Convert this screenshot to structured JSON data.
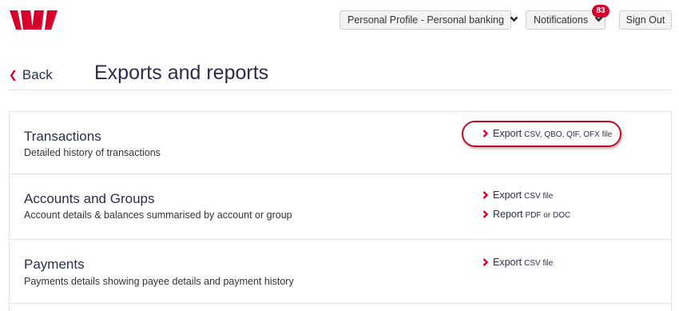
{
  "header": {
    "brand_color": "#d5002b",
    "logo_icon": "westpac-w-logo",
    "profile_label": "Personal Profile - Personal banking",
    "notifications_label": "Notifications",
    "notifications_count": "83",
    "signout_label": "Sign Out"
  },
  "nav": {
    "back_label": "Back"
  },
  "page": {
    "title": "Exports and reports"
  },
  "rows": [
    {
      "title": "Transactions",
      "description": "Detailed history of transactions",
      "actions": [
        {
          "verb": "Export",
          "formats": "CSV, QBO, QIF, OFX file",
          "highlighted": true
        }
      ]
    },
    {
      "title": "Accounts and Groups",
      "description": "Account details & balances summarised by account or group",
      "actions": [
        {
          "verb": "Export",
          "formats": "CSV file"
        },
        {
          "verb": "Report",
          "formats": "PDF or DOC"
        }
      ]
    },
    {
      "title": "Payments",
      "description": "Payments details showing payee details and payment history",
      "actions": [
        {
          "verb": "Export",
          "formats": "CSV file"
        }
      ]
    }
  ]
}
